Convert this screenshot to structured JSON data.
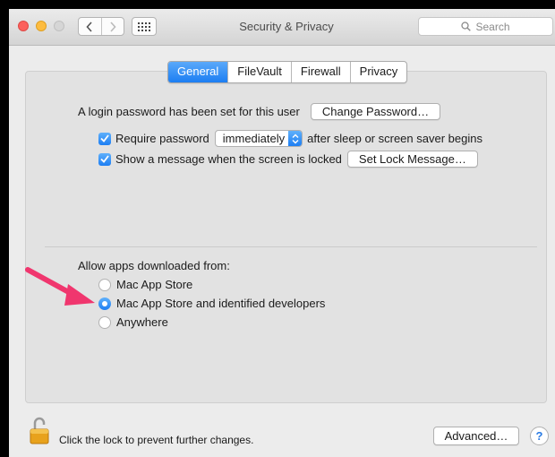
{
  "window": {
    "title": "Security & Privacy",
    "search_placeholder": "Search"
  },
  "tabs": [
    {
      "label": "General",
      "active": true
    },
    {
      "label": "FileVault",
      "active": false
    },
    {
      "label": "Firewall",
      "active": false
    },
    {
      "label": "Privacy",
      "active": false
    }
  ],
  "general": {
    "login_text": "A login password has been set for this user",
    "change_password_button": "Change Password…",
    "require_password_label": "Require password",
    "require_password_checked": true,
    "require_password_delay": "immediately",
    "require_password_suffix": "after sleep or screen saver begins",
    "show_message_label": "Show a message when the screen is locked",
    "show_message_checked": true,
    "set_lock_message_button": "Set Lock Message…"
  },
  "allow_apps": {
    "heading": "Allow apps downloaded from:",
    "options": [
      {
        "label": "Mac App Store",
        "selected": false
      },
      {
        "label": "Mac App Store and identified developers",
        "selected": true
      },
      {
        "label": "Anywhere",
        "selected": false
      }
    ]
  },
  "footer": {
    "lock_text": "Click the lock to prevent further changes.",
    "advanced_button": "Advanced…",
    "help_label": "?"
  },
  "colors": {
    "accent": "#1c7ef2",
    "annotation_arrow": "#f0366e",
    "window_background": "#ececec"
  },
  "icons": [
    "back-icon",
    "forward-icon",
    "grid-icon",
    "search-icon",
    "checkmark-icon",
    "stepper-arrows-icon",
    "lock-open-icon",
    "annotation-arrow"
  ]
}
